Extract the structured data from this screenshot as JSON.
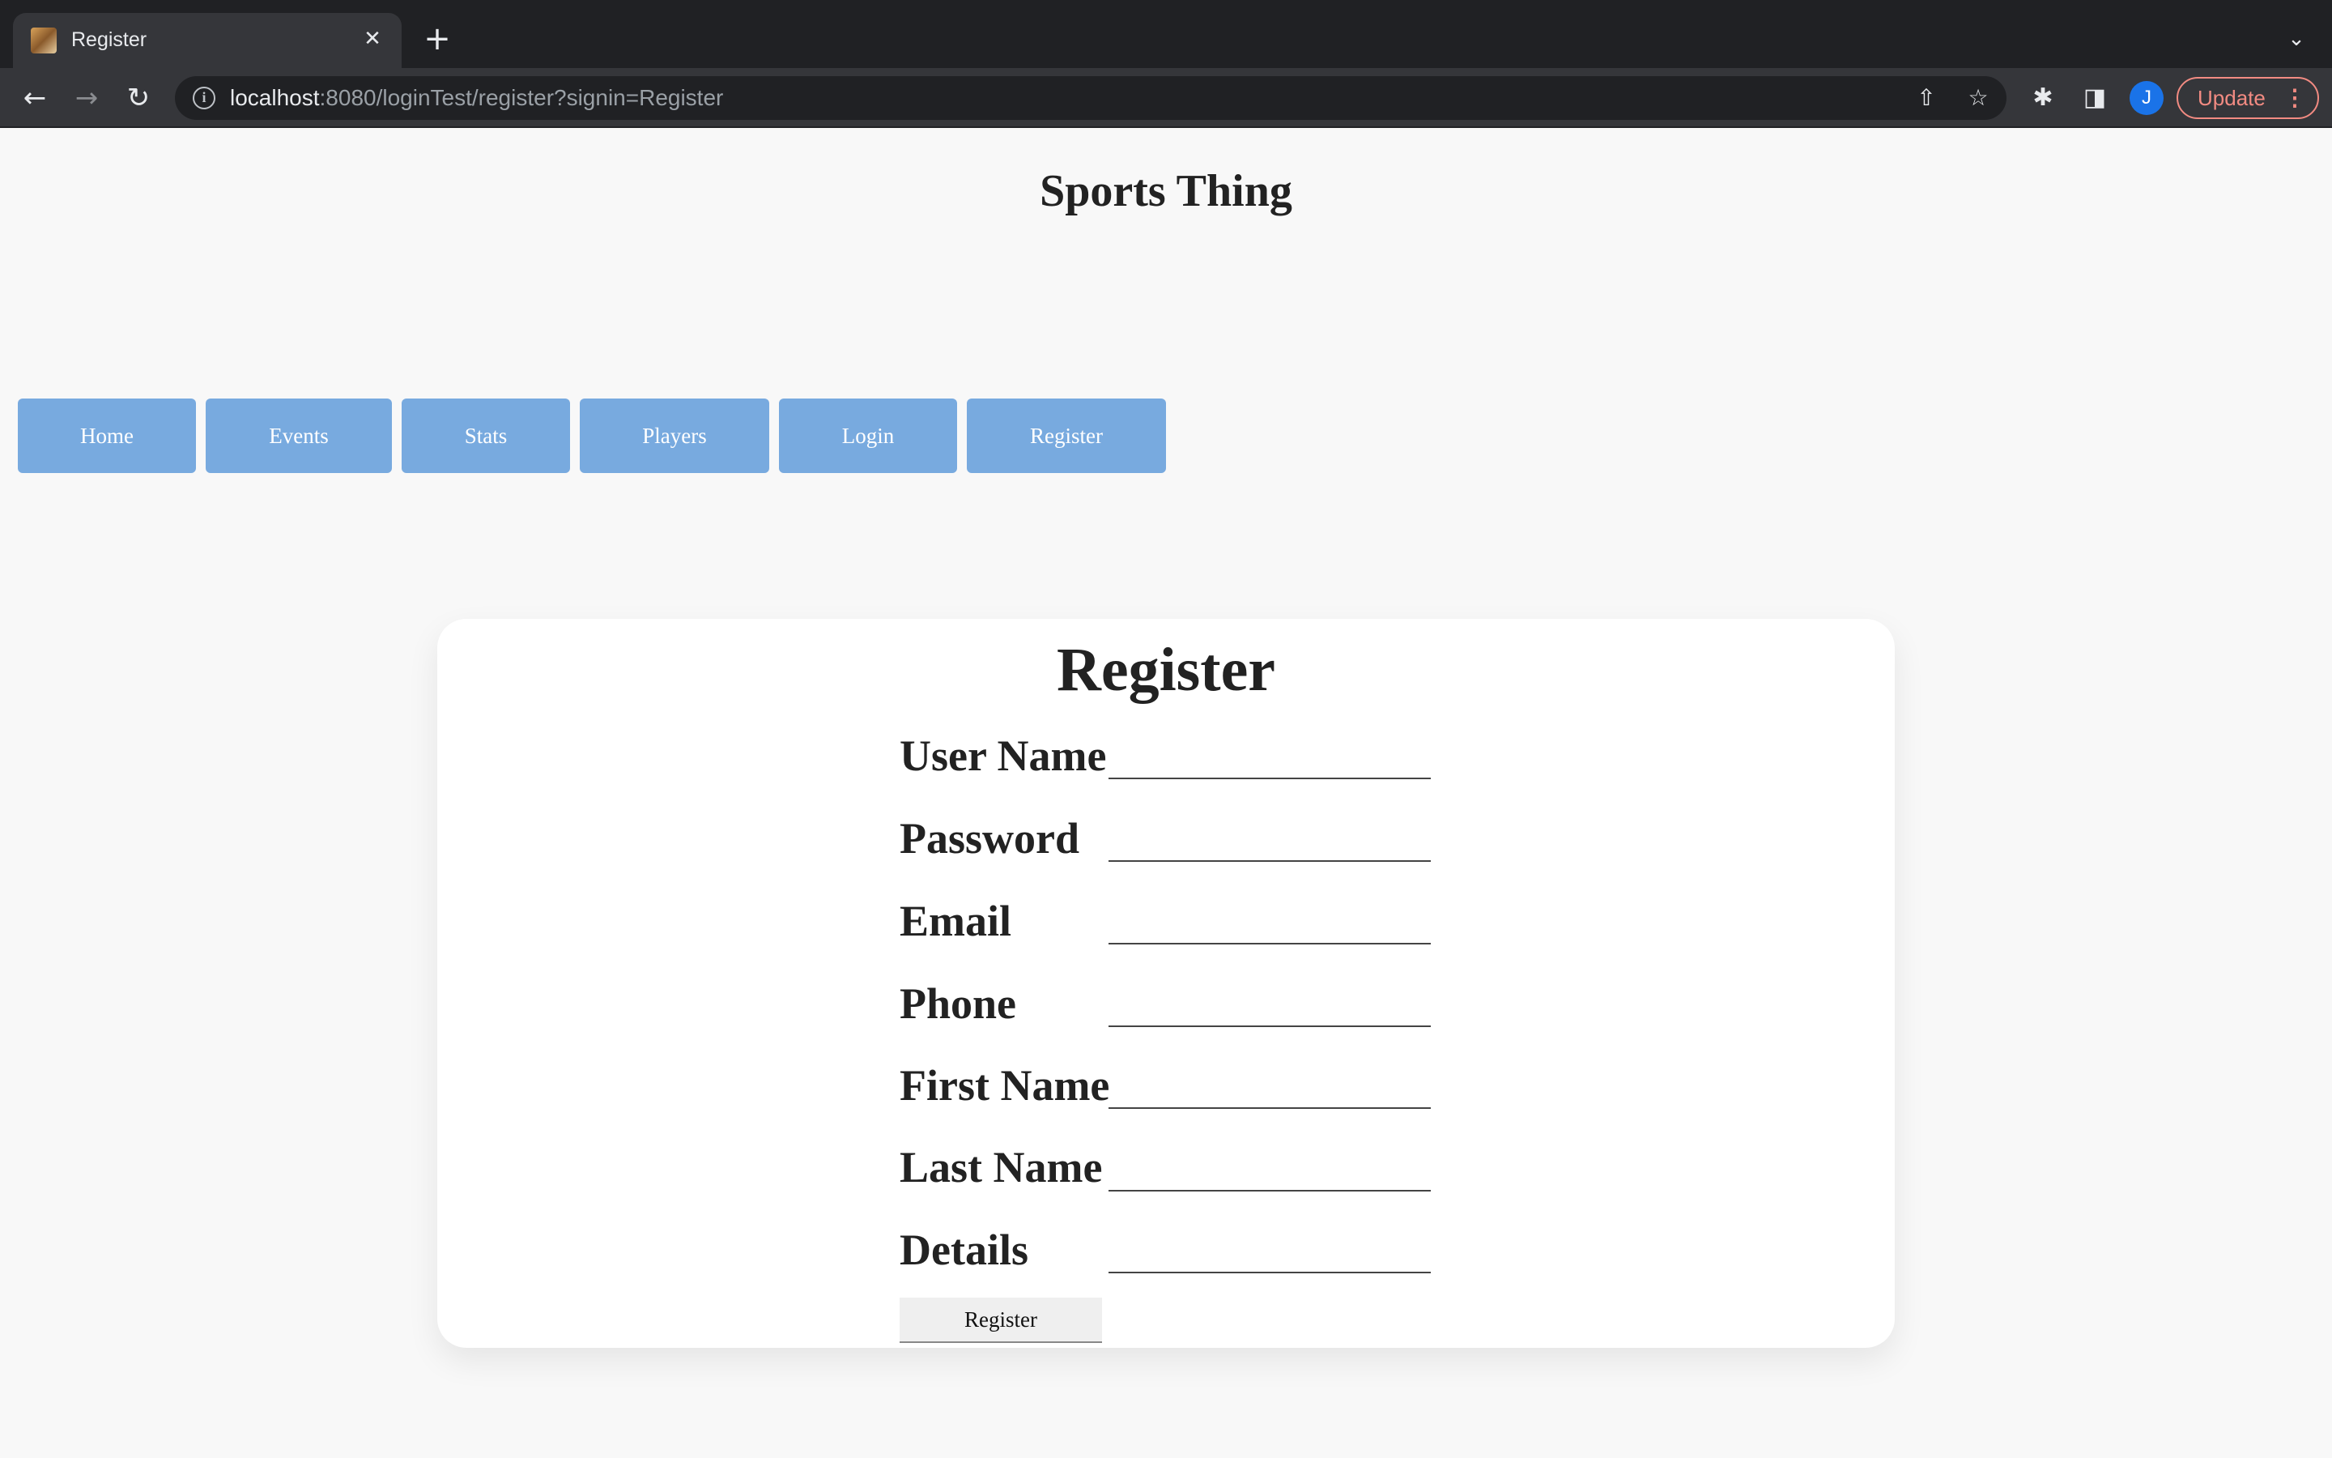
{
  "browser": {
    "tab": {
      "title": "Register",
      "close_glyph": "✕"
    },
    "new_tab_glyph": "+",
    "tab_list_glyph": "⌄",
    "nav": {
      "back_glyph": "←",
      "forward_glyph": "→",
      "reload_glyph": "↻"
    },
    "address": {
      "info_glyph": "i",
      "host": "localhost",
      "rest": ":8080/loginTest/register?signin=Register"
    },
    "toolbar": {
      "share_glyph": "⇧",
      "bookmark_glyph": "☆",
      "extensions_glyph": "✱",
      "side_panel_glyph": "◨",
      "avatar_initial": "J",
      "update_label": "Update",
      "menu_glyph": "⋮"
    }
  },
  "site": {
    "title": "Sports Thing",
    "nav": [
      "Home",
      "Events",
      "Stats",
      "Players",
      "Login",
      "Register"
    ]
  },
  "form": {
    "title": "Register",
    "fields": [
      {
        "label": "User Name",
        "value": ""
      },
      {
        "label": "Password",
        "value": ""
      },
      {
        "label": "Email",
        "value": ""
      },
      {
        "label": "Phone",
        "value": ""
      },
      {
        "label": "First Name",
        "value": ""
      },
      {
        "label": "Last Name",
        "value": ""
      },
      {
        "label": "Details",
        "value": ""
      }
    ],
    "submit_label": "Register"
  },
  "colors": {
    "nav_button": "#78aadf",
    "page_background": "#f8f8f8",
    "update_accent": "#f28b82",
    "avatar": "#1a73e8"
  }
}
